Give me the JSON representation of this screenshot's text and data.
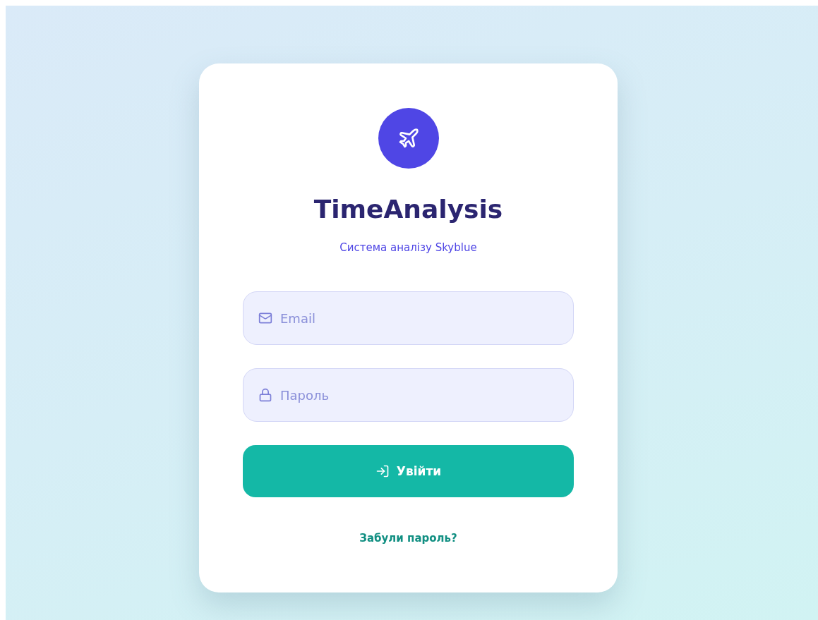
{
  "app": {
    "title": "TimeAnalysis",
    "subtitle": "Система аналізу Skyblue"
  },
  "fields": [
    {
      "kind": "email",
      "placeholder": "Email"
    },
    {
      "kind": "password",
      "placeholder": "Пароль"
    }
  ],
  "login_button": {
    "label": "Увійти"
  },
  "forgot_link": "Забули пароль?"
}
